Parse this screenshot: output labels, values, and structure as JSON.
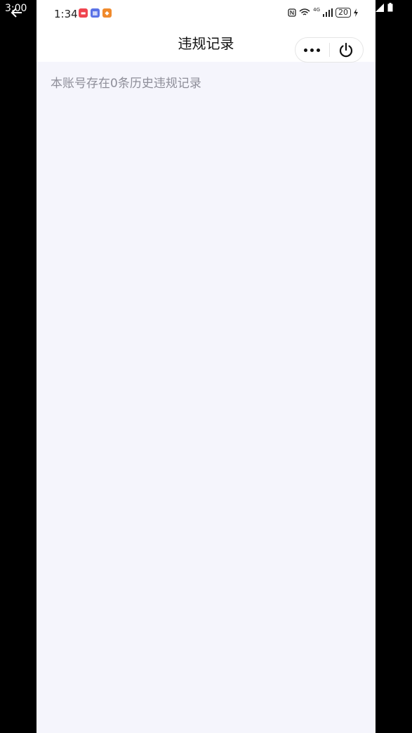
{
  "outer_status": {
    "time": "3:00"
  },
  "status_bar": {
    "time": "1:34",
    "battery": "20",
    "network": "4G"
  },
  "nav": {
    "title": "违规记录"
  },
  "content": {
    "note": "本账号存在0条历史违规记录"
  },
  "colors": {
    "page_background": "#f5f5fc",
    "note_text": "#8e8e99"
  },
  "icons": [
    "back-arrow-icon",
    "more-dots-icon",
    "power-icon",
    "wifi-icon",
    "signal-icon",
    "nfc-icon",
    "charging-icon"
  ]
}
